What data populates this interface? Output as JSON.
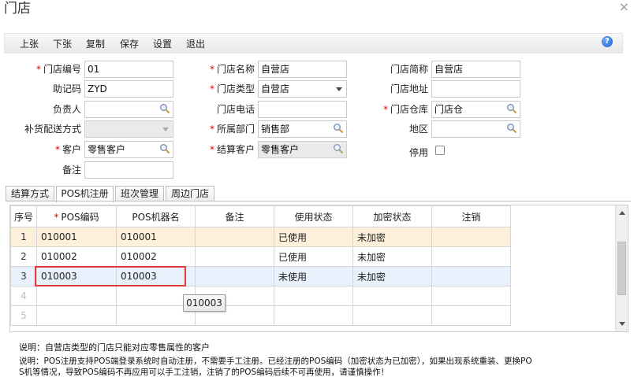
{
  "window": {
    "title": "门店",
    "close_glyph": "×"
  },
  "toolbar": {
    "items": [
      "上张",
      "下张",
      "复制",
      "保存",
      "设置",
      "退出"
    ],
    "help_glyph": "?"
  },
  "form": {
    "store_code": {
      "label": "门店编号",
      "value": "01"
    },
    "mnemonic": {
      "label": "助记码",
      "value": "ZYD"
    },
    "manager": {
      "label": "负责人",
      "value": ""
    },
    "replenish_mode": {
      "label": "补货配送方式",
      "value": ""
    },
    "customer": {
      "label": "客户",
      "value": "零售客户"
    },
    "remark": {
      "label": "备注",
      "value": ""
    },
    "store_name": {
      "label": "门店名称",
      "value": "自营店"
    },
    "store_type": {
      "label": "门店类型",
      "value": "自营店"
    },
    "store_phone": {
      "label": "门店电话",
      "value": ""
    },
    "department": {
      "label": "所属部门",
      "value": "销售部"
    },
    "settle_customer": {
      "label": "结算客户",
      "value": "零售客户"
    },
    "store_short": {
      "label": "门店简称",
      "value": "自营店"
    },
    "store_address": {
      "label": "门店地址",
      "value": ""
    },
    "store_warehouse": {
      "label": "门店仓库",
      "value": "门店仓"
    },
    "region": {
      "label": "地区",
      "value": ""
    },
    "disabled_flag": {
      "label": "停用",
      "checked": false
    },
    "required_mark": "*"
  },
  "tabs": [
    "结算方式",
    "POS机注册",
    "班次管理",
    "周边门店"
  ],
  "active_tab": "POS机注册",
  "grid": {
    "required_mark": "*",
    "headers": [
      "序号",
      "POS编码",
      "POS机器名",
      "备注",
      "使用状态",
      "加密状态",
      "注销"
    ],
    "rows": [
      {
        "no": "1",
        "code": "010001",
        "name": "010001",
        "remark": "",
        "use": "已使用",
        "enc": "未加密",
        "cancel": ""
      },
      {
        "no": "2",
        "code": "010002",
        "name": "010002",
        "remark": "",
        "use": "已使用",
        "enc": "未加密",
        "cancel": ""
      },
      {
        "no": "3",
        "code": "010003",
        "name": "010003",
        "remark": "",
        "use": "未使用",
        "enc": "未加密",
        "cancel": ""
      },
      {
        "no": "4",
        "code": "",
        "name": "",
        "remark": "",
        "use": "",
        "enc": "",
        "cancel": ""
      },
      {
        "no": "5",
        "code": "",
        "name": "",
        "remark": "",
        "use": "",
        "enc": "",
        "cancel": ""
      }
    ]
  },
  "tooltip": "010003",
  "notes": {
    "line1": "说明：自营店类型的门店只能对应零售属性的客户",
    "line2": "说明：POS注册支持POS端登录系统时自动注册，不需要手工注册。已经注册的POS编码（加密状态为已加密），如果出现系统重装、更换PO",
    "line3": "S机等情况，导致POS编码不再应用可以手工注销，注销了的POS编码后续不可再使用，请谨慎操作！"
  },
  "colors": {
    "required": "#dd0000",
    "highlight_border": "#e03a3a",
    "row_selected": "#fdf0da",
    "row_hover": "#e8f0fb",
    "help_icon": "#1f5fc8"
  }
}
